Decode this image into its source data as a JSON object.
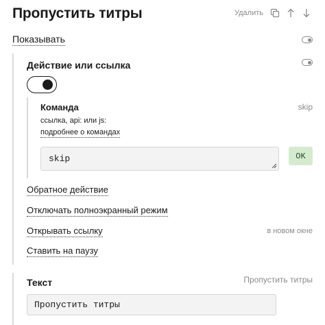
{
  "header": {
    "title": "Пропустить титры",
    "delete_label": "Удалить",
    "actions": [
      "copy-icon",
      "arrow-up-icon",
      "arrow-down-icon"
    ]
  },
  "show": {
    "label": "Показывать"
  },
  "action": {
    "title": "Действие или ссылка",
    "toggle_on": true,
    "command": {
      "title": "Команда",
      "value_label": "skip",
      "description": "ссылка, api: или js:",
      "help_link": "подробнее о командах",
      "input_value": "skip",
      "ok_label": "OK"
    },
    "options": [
      {
        "label": "Обратное действие",
        "note": ""
      },
      {
        "label": "Отключать полноэкранный режим",
        "note": ""
      },
      {
        "label": "Открывать ссылку",
        "note": "в новом окне"
      },
      {
        "label": "Ставить на паузу",
        "note": ""
      }
    ]
  },
  "text_section": {
    "title": "Текст",
    "current_label": "Пропустить титры",
    "input_value": "Пропустить титры"
  }
}
